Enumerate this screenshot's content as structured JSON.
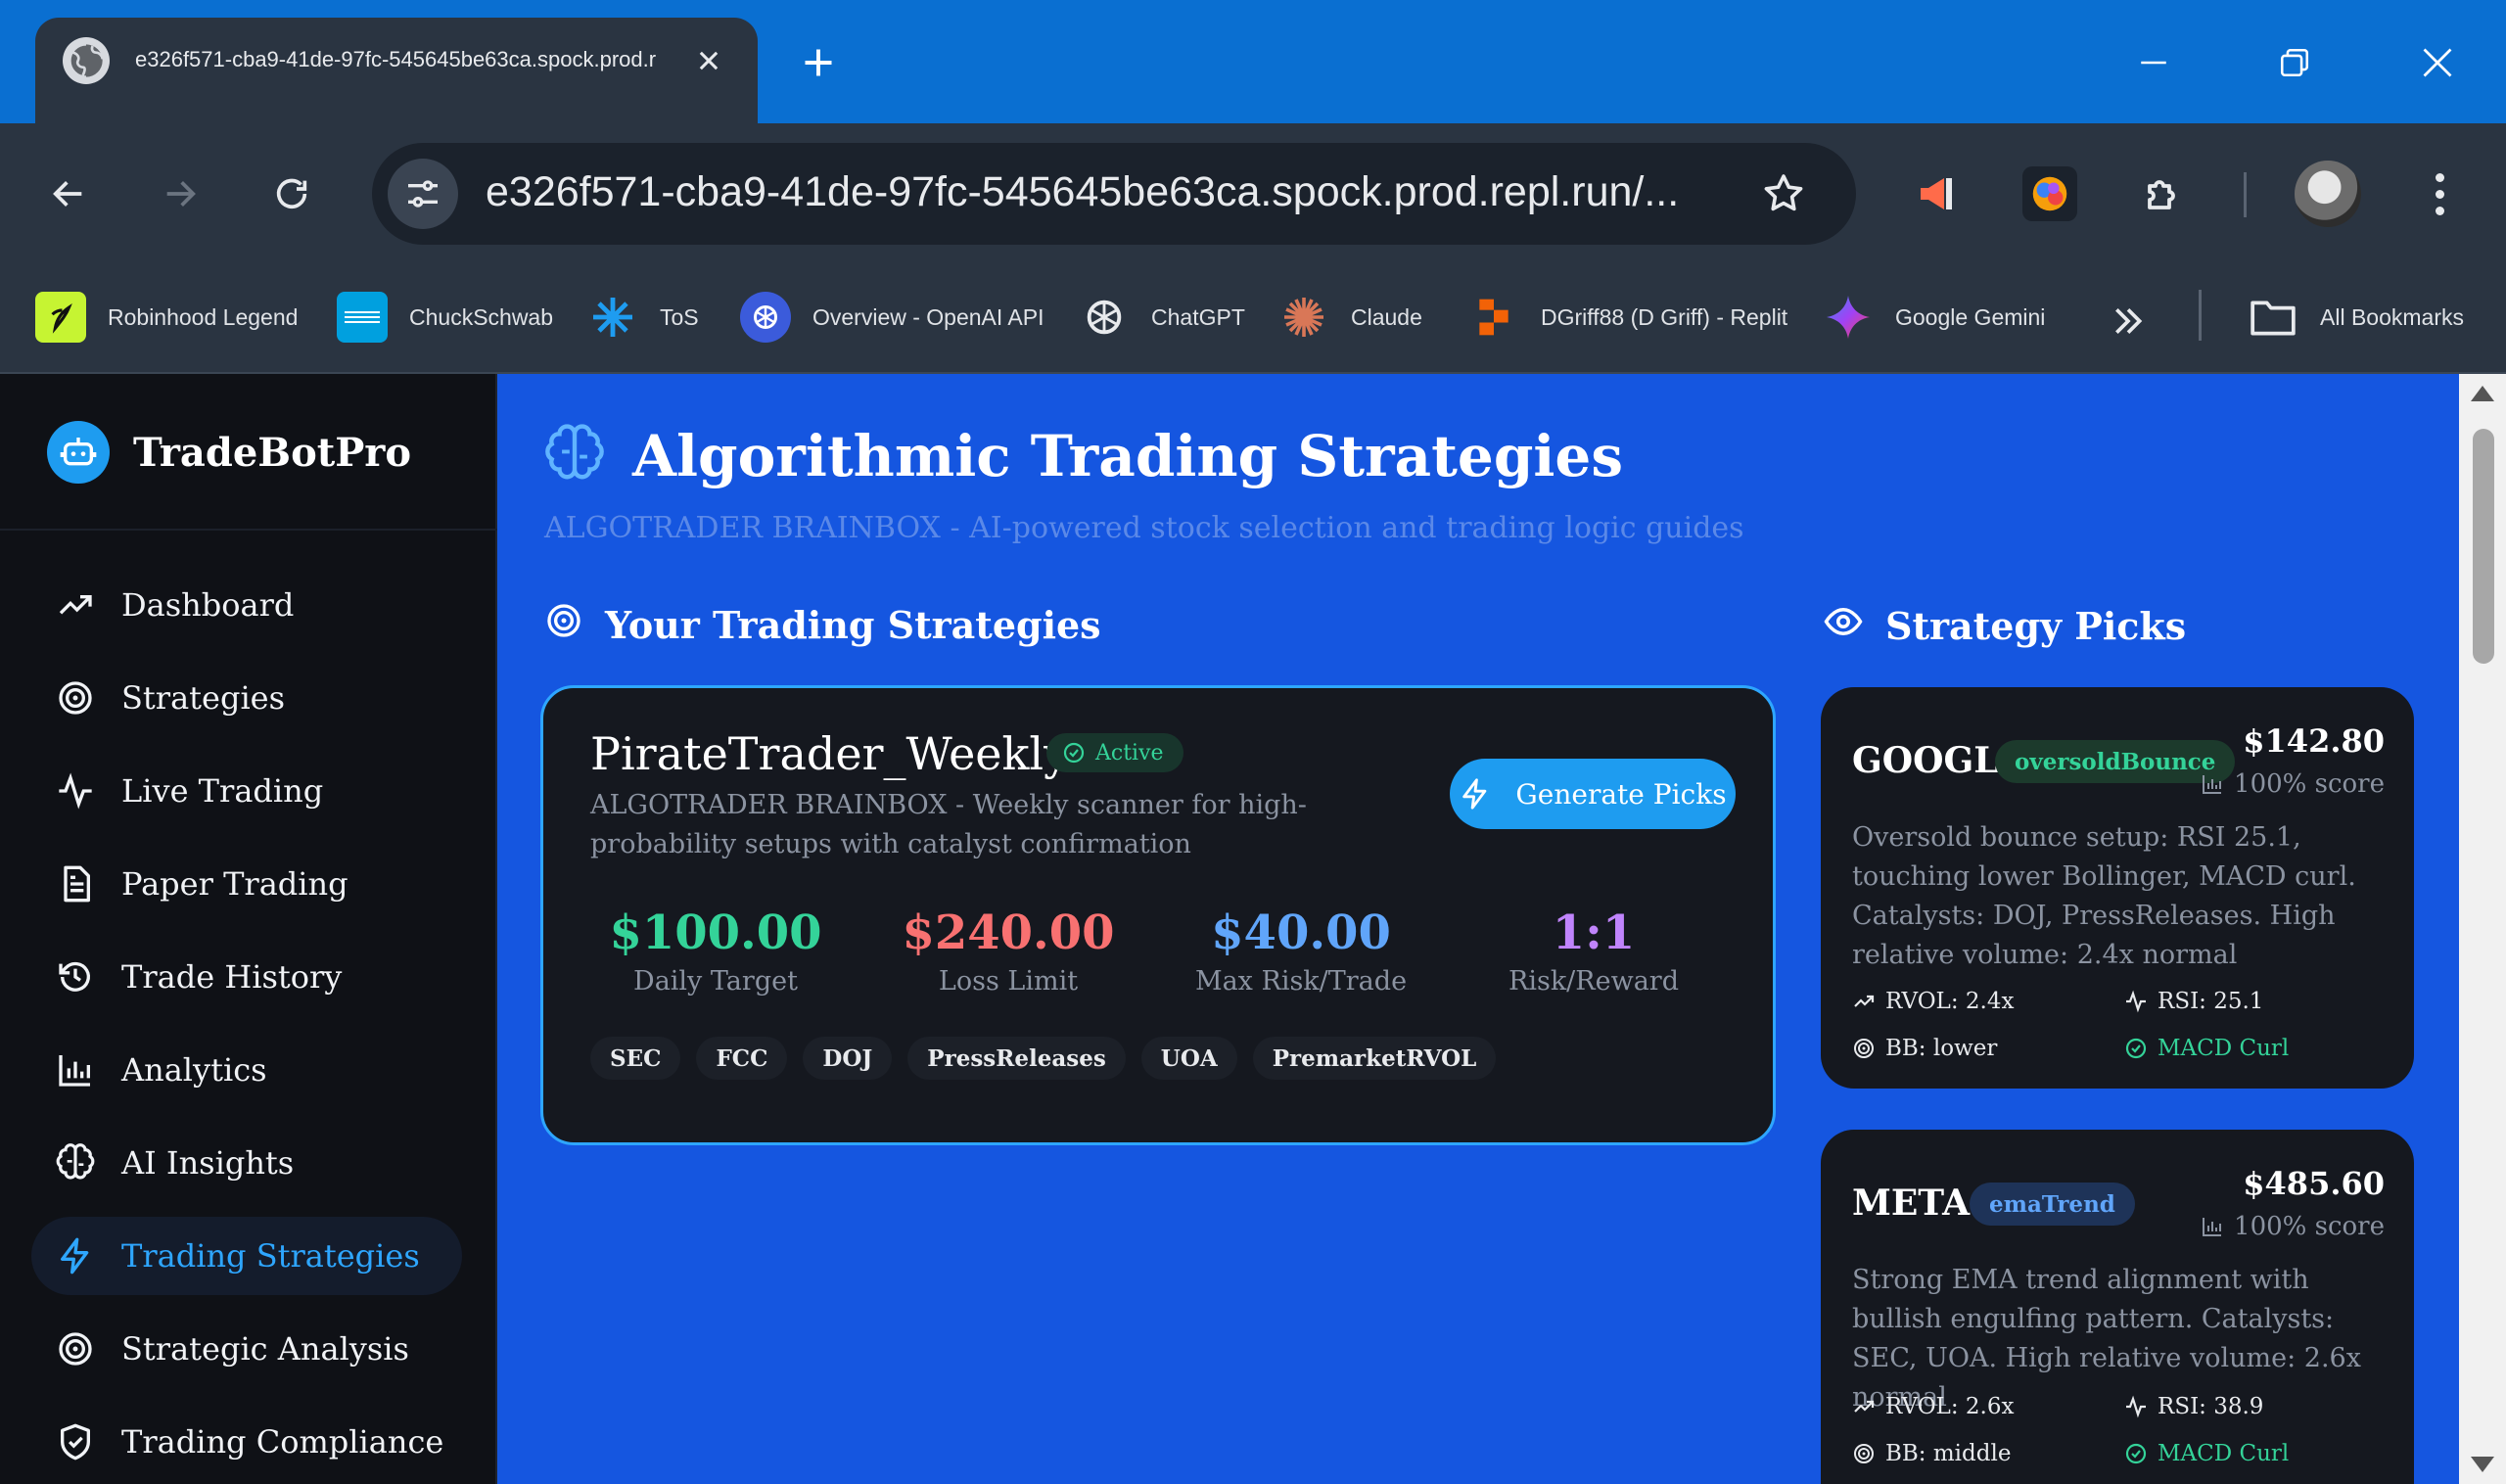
{
  "browser": {
    "tab_title": "e326f571-cba9-41de-97fc-545645be63ca.spock.prod.r",
    "url": "e326f571-cba9-41de-97fc-545645be63ca.spock.prod.repl.run/...",
    "bookmarks": [
      {
        "label": "Robinhood Legend",
        "icon": "robinhood-icon",
        "color": "#c6f432"
      },
      {
        "label": "ChuckSchwab",
        "icon": "schwab-icon",
        "color": "#00a0df"
      },
      {
        "label": "ToS",
        "icon": "tos-icon",
        "color": "#1e9cf0"
      },
      {
        "label": "Overview - OpenAI API",
        "icon": "openai-icon",
        "color": "#3b5bdb"
      },
      {
        "label": "ChatGPT",
        "icon": "chatgpt-icon",
        "color": "#e8eaed"
      },
      {
        "label": "Claude",
        "icon": "claude-icon",
        "color": "#d97757"
      },
      {
        "label": "DGriff88 (D Griff) - Replit",
        "icon": "replit-icon",
        "color": "#f26207"
      },
      {
        "label": "Google Gemini",
        "icon": "gemini-icon",
        "color": "#4285f4"
      }
    ],
    "all_bookmarks": "All Bookmarks"
  },
  "sidebar": {
    "brand": "TradeBotPro",
    "items": [
      {
        "label": "Dashboard",
        "icon": "trend-up-icon",
        "active": false
      },
      {
        "label": "Strategies",
        "icon": "target-icon",
        "active": false
      },
      {
        "label": "Live Trading",
        "icon": "activity-icon",
        "active": false
      },
      {
        "label": "Paper Trading",
        "icon": "document-icon",
        "active": false
      },
      {
        "label": "Trade History",
        "icon": "history-icon",
        "active": false
      },
      {
        "label": "Analytics",
        "icon": "bar-chart-icon",
        "active": false
      },
      {
        "label": "AI Insights",
        "icon": "brain-icon",
        "active": false
      },
      {
        "label": "Trading Strategies",
        "icon": "lightning-icon",
        "active": true
      },
      {
        "label": "Strategic Analysis",
        "icon": "target-icon",
        "active": false
      },
      {
        "label": "Trading Compliance",
        "icon": "shield-icon",
        "active": false
      }
    ]
  },
  "main": {
    "title": "Algorithmic Trading Strategies",
    "subtitle": "ALGOTRADER BRAINBOX - AI-powered stock selection and trading logic guides",
    "your_strategies_heading": "Your Trading Strategies",
    "picks_heading": "Strategy Picks",
    "strategy": {
      "name": "PirateTrader_Weekly",
      "status": "Active",
      "description": "ALGOTRADER BRAINBOX - Weekly scanner for high-probability setups with catalyst confirmation",
      "generate_label": "Generate Picks",
      "metrics": [
        {
          "value": "$100.00",
          "label": "Daily Target",
          "color": "#34d399"
        },
        {
          "value": "$240.00",
          "label": "Loss Limit",
          "color": "#f87171"
        },
        {
          "value": "$40.00",
          "label": "Max Risk/Trade",
          "color": "#60a5fa"
        },
        {
          "value": "1:1",
          "label": "Risk/Reward",
          "color": "#c084fc"
        }
      ],
      "tags": [
        "SEC",
        "FCC",
        "DOJ",
        "PressReleases",
        "UOA",
        "PremarketRVOL"
      ]
    },
    "picks": [
      {
        "symbol": "GOOGL",
        "setup": "oversoldBounce",
        "setup_bg": "#1c3a2c",
        "setup_color": "#34d399",
        "price": "$142.80",
        "score": "100% score",
        "description": "Oversold bounce setup: RSI 25.1, touching lower Bollinger, MACD curl. Catalysts: DOJ, PressReleases. High relative volume: 2.4x normal",
        "rvol": "RVOL: 2.4x",
        "rsi": "RSI: 25.1",
        "bb": "BB: lower",
        "macd": "MACD Curl"
      },
      {
        "symbol": "META",
        "setup": "emaTrend",
        "setup_bg": "#1e3358",
        "setup_color": "#60a5fa",
        "price": "$485.60",
        "score": "100% score",
        "description": "Strong EMA trend alignment with bullish engulfing pattern. Catalysts: SEC, UOA. High relative volume: 2.6x normal",
        "rvol": "RVOL: 2.6x",
        "rsi": "RSI: 38.9",
        "bb": "BB: middle",
        "macd": "MACD Curl"
      }
    ]
  }
}
